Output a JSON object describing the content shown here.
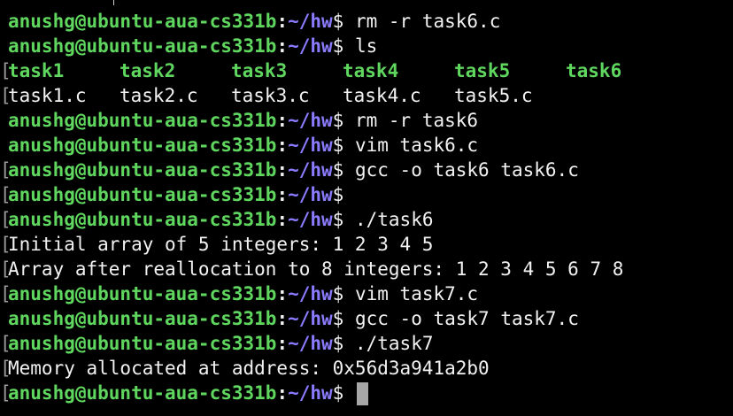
{
  "prompt": {
    "user_host": "anushg@ubuntu-aua-cs331b",
    "colon": ":",
    "path": "~/hw",
    "symbol": "$"
  },
  "colors": {
    "background": "#000000",
    "prompt_user": "#5fd75f",
    "prompt_path": "#8a7bff",
    "text": "#f2f2f2",
    "cursor": "#a7a7a7"
  },
  "lines": [
    {
      "type": "prompt",
      "marked": false,
      "command": "rm -r task6.c"
    },
    {
      "type": "prompt",
      "marked": false,
      "command": "ls"
    },
    {
      "type": "ls",
      "marked": true,
      "entries": [
        "task1",
        "task2",
        "task3",
        "task4",
        "task5",
        "task6"
      ],
      "kind": "dir"
    },
    {
      "type": "ls",
      "marked": true,
      "entries": [
        "task1.c",
        "task2.c",
        "task3.c",
        "task4.c",
        "task5.c"
      ],
      "kind": "file"
    },
    {
      "type": "prompt",
      "marked": false,
      "command": "rm -r task6"
    },
    {
      "type": "prompt",
      "marked": false,
      "command": "vim task6.c"
    },
    {
      "type": "prompt",
      "marked": true,
      "command": "gcc -o task6 task6.c"
    },
    {
      "type": "prompt",
      "marked": true,
      "command": ""
    },
    {
      "type": "prompt",
      "marked": true,
      "command": "./task6"
    },
    {
      "type": "output",
      "marked": true,
      "text": "Initial array of 5 integers: 1 2 3 4 5"
    },
    {
      "type": "output",
      "marked": true,
      "text": "Array after reallocation to 8 integers: 1 2 3 4 5 6 7 8"
    },
    {
      "type": "prompt",
      "marked": true,
      "command": "vim task7.c"
    },
    {
      "type": "prompt",
      "marked": false,
      "command": "gcc -o task7 task7.c"
    },
    {
      "type": "prompt",
      "marked": true,
      "command": "./task7"
    },
    {
      "type": "output",
      "marked": true,
      "text": "Memory allocated at address: 0x56d3a941a2b0"
    },
    {
      "type": "prompt",
      "marked": true,
      "command": "",
      "cursor": true
    }
  ],
  "line_mark": "["
}
